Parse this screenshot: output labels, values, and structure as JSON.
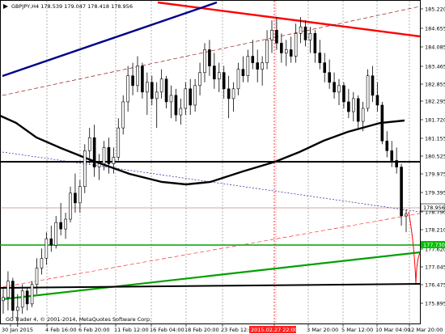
{
  "header": {
    "symbol_info": "GBPJPY,H4  178.539 179.047 178.418 178.956"
  },
  "footer": {
    "copyright": "GC Trader 4, © 2001-2014, MetaQuotes Software Corp."
  },
  "colors": {
    "background": "#ffffff",
    "candle": "#000000",
    "resistance_line": "#ff0000",
    "channel_line": "#00008b",
    "support_line": "#00a000",
    "moving_average": "#000000",
    "price_tag_bid": "#ffffff",
    "price_tag_green": "#00c000",
    "time_highlight": "#ff2020",
    "grid": "#808080"
  },
  "chart_data": {
    "type": "candlestick",
    "symbol": "GBPJPY",
    "timeframe": "H4",
    "ohlc_last": {
      "open": 178.539,
      "high": 179.047,
      "low": 178.418,
      "close": 178.956
    },
    "ylim": [
      175.6,
      185.5
    ],
    "y_ticks": [
      "185.220",
      "184.655",
      "184.085",
      "183.465",
      "182.855",
      "182.295",
      "181.720",
      "181.155",
      "180.525",
      "179.975",
      "179.395",
      "178.790",
      "178.210",
      "177.620",
      "177.045",
      "176.475",
      "175.895"
    ],
    "x_ticks": [
      "30 Jan 2015",
      "4 Feb 16:00",
      "6 Feb 20:00",
      "11 Feb 12:00",
      "16 Feb 04:00",
      "18 Feb 20:00",
      "23 Feb 12:00",
      "2015.02.27 22:00",
      "3 Mar 20:00",
      "5 Mar 12:00",
      "10 Mar 04:00",
      "12 Mar 20:00"
    ],
    "current_price_tag": "178.956",
    "green_level_tag": "177.730",
    "highlight_time_tag": "2015.02.27 22:00",
    "horizontal_levels": {
      "resistance": 180.4,
      "bid": 178.956,
      "green": 177.73,
      "support": 176.55
    },
    "moving_average": [
      [
        0,
        182.0
      ],
      [
        20,
        181.6
      ],
      [
        45,
        181.0
      ],
      [
        75,
        180.6
      ],
      [
        110,
        180.35
      ],
      [
        160,
        179.9
      ],
      [
        200,
        179.55
      ],
      [
        230,
        179.5
      ],
      [
        260,
        179.6
      ],
      [
        300,
        179.95
      ],
      [
        340,
        180.4
      ],
      [
        370,
        180.8
      ],
      [
        400,
        181.2
      ],
      [
        430,
        181.5
      ],
      [
        470,
        181.75
      ],
      [
        500,
        181.7
      ]
    ],
    "candles": [
      [
        176.3,
        176.7,
        175.9,
        176.4
      ],
      [
        176.4,
        177.2,
        176.0,
        176.9
      ],
      [
        176.9,
        177.0,
        175.7,
        176.0
      ],
      [
        176.0,
        176.5,
        175.5,
        176.1
      ],
      [
        176.1,
        176.8,
        175.9,
        176.6
      ],
      [
        176.6,
        176.7,
        176.0,
        176.2
      ],
      [
        176.2,
        176.9,
        176.1,
        176.8
      ],
      [
        176.8,
        177.6,
        176.5,
        177.3
      ],
      [
        177.3,
        177.9,
        177.1,
        177.6
      ],
      [
        177.6,
        178.4,
        177.4,
        178.2
      ],
      [
        178.2,
        178.6,
        177.8,
        178.0
      ],
      [
        178.0,
        178.9,
        177.9,
        178.7
      ],
      [
        178.7,
        179.3,
        178.3,
        178.5
      ],
      [
        178.5,
        179.0,
        178.2,
        178.8
      ],
      [
        178.8,
        179.8,
        178.7,
        179.6
      ],
      [
        179.6,
        180.2,
        179.0,
        179.3
      ],
      [
        179.3,
        180.0,
        179.0,
        179.8
      ],
      [
        179.8,
        181.1,
        179.6,
        180.9
      ],
      [
        180.9,
        181.6,
        180.5,
        181.3
      ],
      [
        181.3,
        181.7,
        180.1,
        180.4
      ],
      [
        180.4,
        180.8,
        180.0,
        180.5
      ],
      [
        180.5,
        181.2,
        180.3,
        181.0
      ],
      [
        181.0,
        181.3,
        180.2,
        180.5
      ],
      [
        180.5,
        181.0,
        180.2,
        180.7
      ],
      [
        180.7,
        181.9,
        180.6,
        181.6
      ],
      [
        181.6,
        182.6,
        181.4,
        182.4
      ],
      [
        182.4,
        183.5,
        182.1,
        183.2
      ],
      [
        183.2,
        183.6,
        182.6,
        182.9
      ],
      [
        182.9,
        183.8,
        182.7,
        183.5
      ],
      [
        183.5,
        183.6,
        182.5,
        182.7
      ],
      [
        182.7,
        183.3,
        182.0,
        183.0
      ],
      [
        183.0,
        183.2,
        182.3,
        182.5
      ],
      [
        182.5,
        183.0,
        181.6,
        182.7
      ],
      [
        182.7,
        183.4,
        182.5,
        183.1
      ],
      [
        183.1,
        183.2,
        182.2,
        182.4
      ],
      [
        182.4,
        182.9,
        181.9,
        182.6
      ],
      [
        182.6,
        182.8,
        181.8,
        182.0
      ],
      [
        182.0,
        182.5,
        181.7,
        182.2
      ],
      [
        182.2,
        183.0,
        182.0,
        182.8
      ],
      [
        182.8,
        183.1,
        182.0,
        182.3
      ],
      [
        182.3,
        183.1,
        182.1,
        182.9
      ],
      [
        182.9,
        183.6,
        182.6,
        183.3
      ],
      [
        183.3,
        184.2,
        183.0,
        184.0
      ],
      [
        184.0,
        184.3,
        183.2,
        183.5
      ],
      [
        183.5,
        183.9,
        182.8,
        183.1
      ],
      [
        183.1,
        183.6,
        182.7,
        183.3
      ],
      [
        183.3,
        183.5,
        182.5,
        182.8
      ],
      [
        182.8,
        183.2,
        181.9,
        182.5
      ],
      [
        182.5,
        183.0,
        182.1,
        182.8
      ],
      [
        182.8,
        183.6,
        182.6,
        183.4
      ],
      [
        183.4,
        183.8,
        183.0,
        183.2
      ],
      [
        183.2,
        184.0,
        183.0,
        183.8
      ],
      [
        183.8,
        184.3,
        183.4,
        183.6
      ],
      [
        183.6,
        184.0,
        183.0,
        183.4
      ],
      [
        183.4,
        183.8,
        182.9,
        183.6
      ],
      [
        183.6,
        184.6,
        183.4,
        184.3
      ],
      [
        184.3,
        184.9,
        183.9,
        184.6
      ],
      [
        184.6,
        185.0,
        184.0,
        184.2
      ],
      [
        184.2,
        184.5,
        183.6,
        183.9
      ],
      [
        183.9,
        184.3,
        183.5,
        184.0
      ],
      [
        184.0,
        184.4,
        183.6,
        183.8
      ],
      [
        183.8,
        184.8,
        183.6,
        184.5
      ],
      [
        184.5,
        185.0,
        184.2,
        184.7
      ],
      [
        184.7,
        184.9,
        184.1,
        184.3
      ],
      [
        184.3,
        184.7,
        183.9,
        184.5
      ],
      [
        184.5,
        184.6,
        183.6,
        183.9
      ],
      [
        183.9,
        184.3,
        183.4,
        183.6
      ],
      [
        183.6,
        183.9,
        183.0,
        183.3
      ],
      [
        183.3,
        183.7,
        182.8,
        183.0
      ],
      [
        183.0,
        183.3,
        182.5,
        182.7
      ],
      [
        182.7,
        183.1,
        182.3,
        182.9
      ],
      [
        182.9,
        183.0,
        182.2,
        182.4
      ],
      [
        182.4,
        182.8,
        181.9,
        182.1
      ],
      [
        182.1,
        182.7,
        181.8,
        182.5
      ],
      [
        182.5,
        182.6,
        181.6,
        181.8
      ],
      [
        181.8,
        182.4,
        181.5,
        182.2
      ],
      [
        182.2,
        183.4,
        182.1,
        183.2
      ],
      [
        183.2,
        183.5,
        182.4,
        182.6
      ],
      [
        182.6,
        183.0,
        182.1,
        182.3
      ],
      [
        182.3,
        182.4,
        181.1,
        181.2
      ],
      [
        181.2,
        181.5,
        180.7,
        180.9
      ],
      [
        180.9,
        181.2,
        180.4,
        180.6
      ],
      [
        180.6,
        181.0,
        180.2,
        180.4
      ],
      [
        180.4,
        180.5,
        178.6,
        178.9
      ],
      [
        178.9,
        179.1,
        178.4,
        178.956
      ]
    ]
  }
}
